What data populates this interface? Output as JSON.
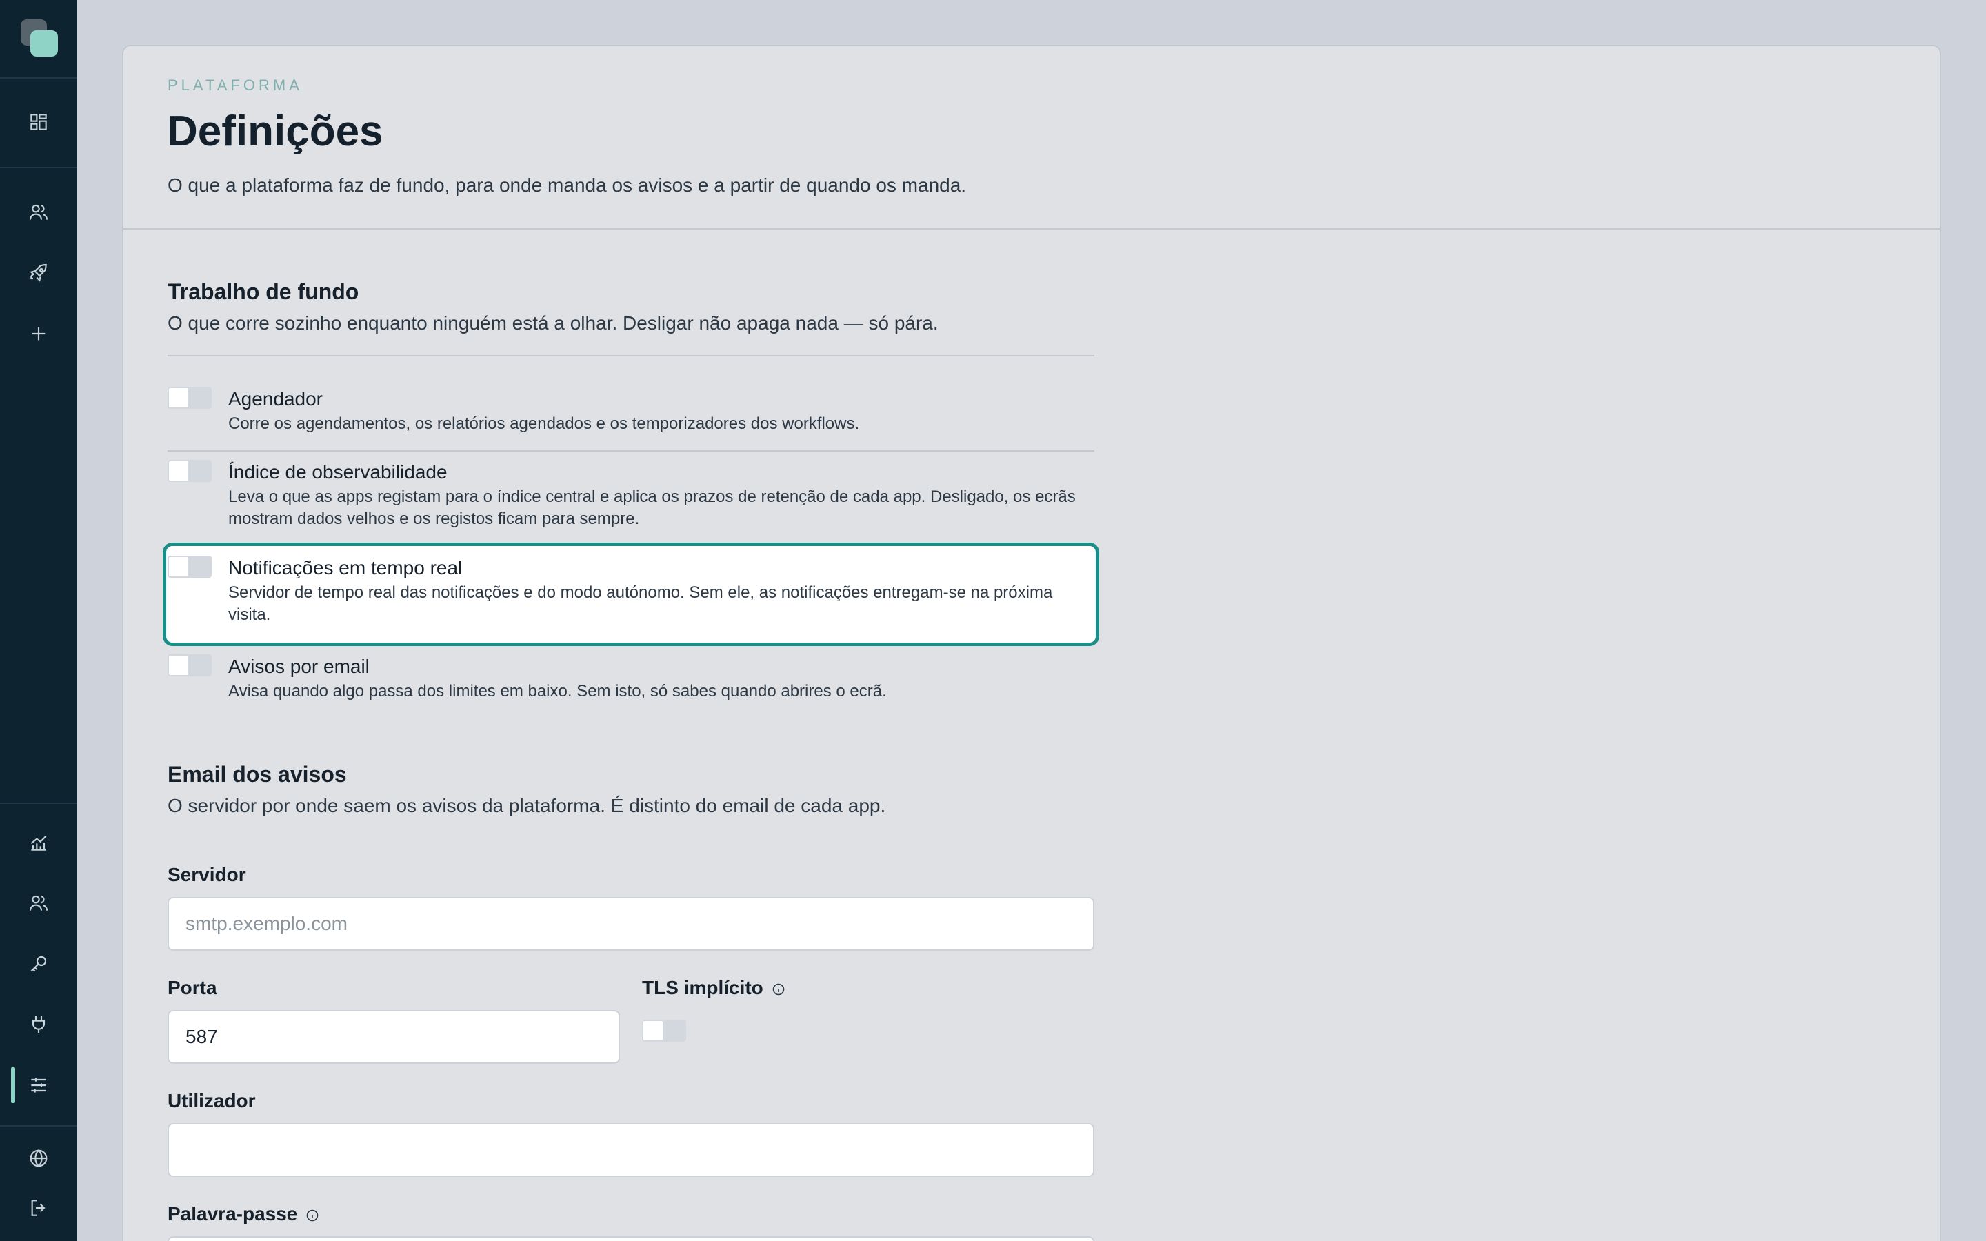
{
  "sidebar": {
    "top_icons": [
      "dashboard-icon",
      "users-icon",
      "rocket-icon",
      "plus-icon"
    ],
    "bottom_icons": [
      "analytics-icon",
      "team-icon",
      "key-icon",
      "plug-icon",
      "settings-sliders-icon",
      "globe-icon",
      "logout-icon"
    ],
    "active": "settings-sliders-icon",
    "accent_color": "#8fd3c7"
  },
  "header": {
    "eyebrow": "PLATAFORMA",
    "title": "Definições",
    "subtitle": "O que a plataforma faz de fundo, para onde manda os avisos e a partir de quando os manda."
  },
  "background": {
    "title": "Trabalho de fundo",
    "subtitle": "O que corre sozinho enquanto ninguém está a olhar. Desligar não apaga nada — só pára.",
    "items": [
      {
        "title": "Agendador",
        "description": "Corre os agendamentos, os relatórios agendados e os temporizadores dos workflows.",
        "enabled": false
      },
      {
        "title": "Índice de observabilidade",
        "description": "Leva o que as apps registam para o índice central e aplica os prazos de retenção de cada app. Desligado, os ecrãs mostram dados velhos e os registos ficam para sempre.",
        "enabled": false
      },
      {
        "title": "Notificações em tempo real",
        "description": "Servidor de tempo real das notificações e do modo autónomo. Sem ele, as notificações entregam-se na próxima visita.",
        "enabled": false,
        "focused": true
      },
      {
        "title": "Avisos por email",
        "description": "Avisa quando algo passa dos limites em baixo. Sem isto, só sabes quando abrires o ecrã.",
        "enabled": false
      }
    ]
  },
  "email": {
    "title": "Email dos avisos",
    "subtitle": "O servidor por onde saem os avisos da plataforma. É distinto do email de cada app.",
    "server_label": "Servidor",
    "server_placeholder": "smtp.exemplo.com",
    "server_value": "",
    "port_label": "Porta",
    "port_value": "587",
    "tls_label": "TLS implícito",
    "tls_enabled": false,
    "user_label": "Utilizador",
    "user_value": "",
    "password_label": "Palavra-passe"
  },
  "colors": {
    "focus_ring": "#1a8f88",
    "sidebar_bg": "#0d2430"
  }
}
